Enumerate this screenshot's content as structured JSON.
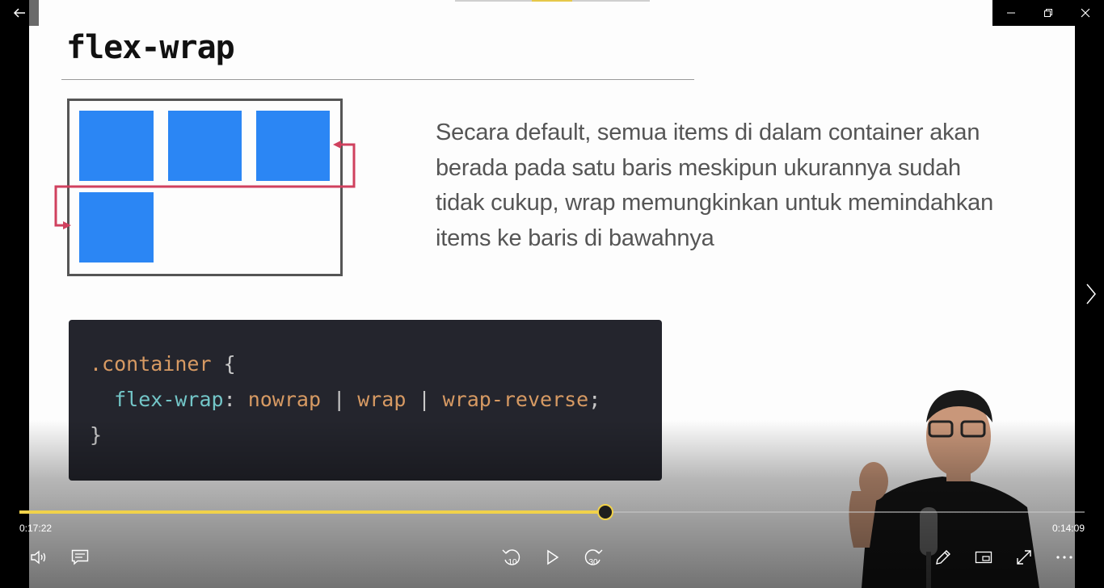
{
  "slide": {
    "title": "flex-wrap",
    "description": "Secara default, semua items di dalam container akan berada pada satu baris meskipun ukurannya sudah tidak cukup, wrap memungkinkan untuk memindahkan items ke baris di bawahnya",
    "code": {
      "selector": ".container",
      "open_brace": "{",
      "property": "flex-wrap",
      "colon": ":",
      "value1": "nowrap",
      "sep1": "|",
      "value2": "wrap",
      "sep2": "|",
      "value3": "wrap-reverse",
      "semicolon": ";",
      "close_brace": "}"
    },
    "colors": {
      "box_blue": "#2b86f4",
      "arrow": "#d0415e",
      "code_bg": "#24252d",
      "accent": "#f1d24a"
    }
  },
  "player": {
    "elapsed": "0:17:22",
    "remaining": "0:14:09",
    "progress": 0.55,
    "skip_back_label": "10",
    "skip_forward_label": "30"
  },
  "icons": {
    "back": "back-arrow-icon",
    "minimize": "minimize-icon",
    "restore": "restore-icon",
    "close": "close-icon",
    "next": "chevron-right-icon",
    "volume": "volume-icon",
    "captions": "captions-icon",
    "skip_back": "skip-back-10-icon",
    "play": "play-icon",
    "skip_forward": "skip-forward-30-icon",
    "pen": "pen-icon",
    "mini_view": "mini-view-icon",
    "fullscreen": "fullscreen-icon",
    "more": "more-icon"
  }
}
